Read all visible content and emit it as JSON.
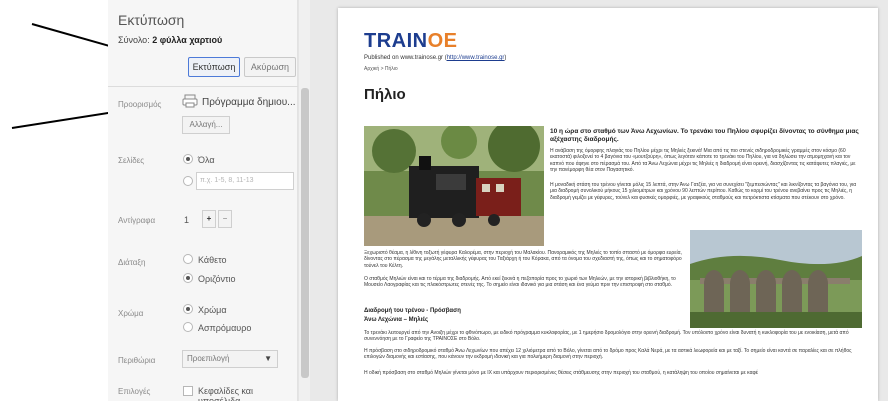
{
  "panel": {
    "title": "Εκτύπωση",
    "total_label": "Σύνολο:",
    "total_value": "2 φύλλα χαρτιού",
    "print_button": "Εκτύπωση",
    "cancel_button": "Ακύρωση",
    "destination_label": "Προορισμός",
    "destination_value": "Πρόγραμμα δημιου...",
    "change_button": "Αλλαγή...",
    "pages_label": "Σελίδες",
    "pages_all": "Όλα",
    "pages_placeholder": "π.χ. 1-5, 8, 11-13",
    "copies_label": "Αντίγραφα",
    "copies_value": "1",
    "copies_plus": "+",
    "copies_minus": "−",
    "layout_label": "Διάταξη",
    "layout_portrait": "Κάθετο",
    "layout_landscape": "Οριζόντιο",
    "color_label": "Χρώμα",
    "color_color": "Χρώμα",
    "color_bw": "Ασπρόμαυρο",
    "margins_label": "Περιθώρια",
    "margins_value": "Προεπιλογή",
    "options_label": "Επιλογές",
    "options_headers": "Κεφαλίδες και υποσέλιδα"
  },
  "preview": {
    "logo_main": "TRAIN",
    "logo_accent": "OE",
    "published": "Published on www.trainose.gr (",
    "published_link": "http://www.trainose.gr",
    "published_end": ")",
    "breadcrumb": "Αρχική > Πήλιο",
    "heading": "Πήλιο",
    "lead": "10 η ώρα στο σταθμό των Άνω Λεχωνίων. Το τρενάκι του Πηλίου σφυρίζει δίνοντας το σύνθημα μιας αξέχαστης διαδρομής.",
    "para1": "Η ανάβαση της όμορφης πλαγιάς του Πηλίου μέχρι τις Μηλιές ξεκινά! Μια από τις πιο στενές σιδηροδρομικές γραμμές στον κόσμο (60 εκατοστά) φιλοξενεί το 4 βαγόνια του «μουτζούρη», όπως λεγόταν κάποτε το τρενάκι του Πηλίου, για να δηλώσει την ατμομηχανή και τον καπνό που άφηνε στο πέρασμά του. Από τα Άνω Λεχώνια μέχρι τις Μηλιές η διαδρομή είναι ορεινή, διασχίζοντας τις κατάφυτες πλαγιές, με την πανέμορφη θέα στον Παγασητικό.",
    "para2": "Η μοναδική στάση του τρένου γίνεται μόλις 15 λεπτά, στην Άνω Γατζέα, για να συνεχίσει \"ξεμπεσιώντας\" και λικνίζοντας τα βαγόνια του, για μια διαδρομή συνολικού μήκους 15 χιλιομέτρων και χρόνου 90 λεπτών περίπου. Καθώς το κορμί του τρένου ανεβαίνει προς τις Μηλιές, η διαδρομή γεμίζει με γέφυρες, τούνελ και φυσικές ομορφιές, με γραφικούς σταθμούς και πετρόκτιστα κτίσματα που στέκουν στο χρόνο.",
    "para3": "Ξεχωριστό θέαμα, η λίθινη τοξωτή γέφυρα Καλορέμα, στην περιοχή του Μαλακίου. Πανοραμικός της Μηλιές το τοπίο σπαστό με όμορφα ευρεία, δίνοντας στο πέρασμα της μεγάλης μεταλλικής γέφυρας του Ταξιάρχη ή του Κόρακα, από τα όνομα του σχεδιαστή της, όπως και το σηματοφόρο τούνελ του Κέλτη.",
    "para4": "Ο σταθμός Μηλιών είναι και το τέρμα της διαδρομής. Από εκεί ξεκινά η πεζοπορία προς το χωριό των Μηλεών, με την ιστορική βιβλιοθήκη, το Μουσείο Λαογραφίας και τις πλακόστρωτες στενές της. Το σημείο είναι ιδανικό για μια στάση και ένα γεύμα πριν την επιστροφή στο σταθμό.",
    "sub1": "Διαδρομή του τρένου - Πρόσβαση",
    "sub2": "Άνω Λεχώνια – Μηλιές",
    "para5": "Το τρενάκι λειτουργεί από την Ανοιξη μέχρι το φθινόπωρο, με ειδικό πρόγραμμα κυκλοφορίας, με 1 ημερήσιο δρομολόγιο στην ορεινή διαδρομή. Τον υπόλοιπο χρόνο είναι δυνατή η κυκλοφορία του με ενοικίαση, μετά από συνεννόηση με το Γραφείο της ΤΡΑΙΝΟΣΕ στο Βόλο.",
    "para6": "Η πρόσβαση στο σιδηροδρομικό σταθμό Άνω Λεχωνίων που απέχει 12 χιλιόμετρα από το Βόλο, γίνεται από το δρόμο προς Καλά Νερά, με τα αστικά λεωφορεία και με ταξί. Το σημείο είναι κοντά σε παραλίες και σε πλήθος επιλογών διαμονής και εστίασης, που κάνουν την εκδρομή ιδανική και για πολυήμερη διαμονή στην περιοχή.",
    "para7": "Η οδική πρόσβαση στο σταθμό Μηλιών γίνεται μόνο με ΙΧ και υπάρχουν περιορισμένες θέσεις στάθμευσης στην περιοχή του σταθμού, η κατάληψη του οποίου σημαίνεται με καφέ"
  },
  "colors": {
    "accent_blue": "#4d7ad8",
    "logo_blue": "#1d3d8f",
    "logo_orange": "#e8802a"
  }
}
